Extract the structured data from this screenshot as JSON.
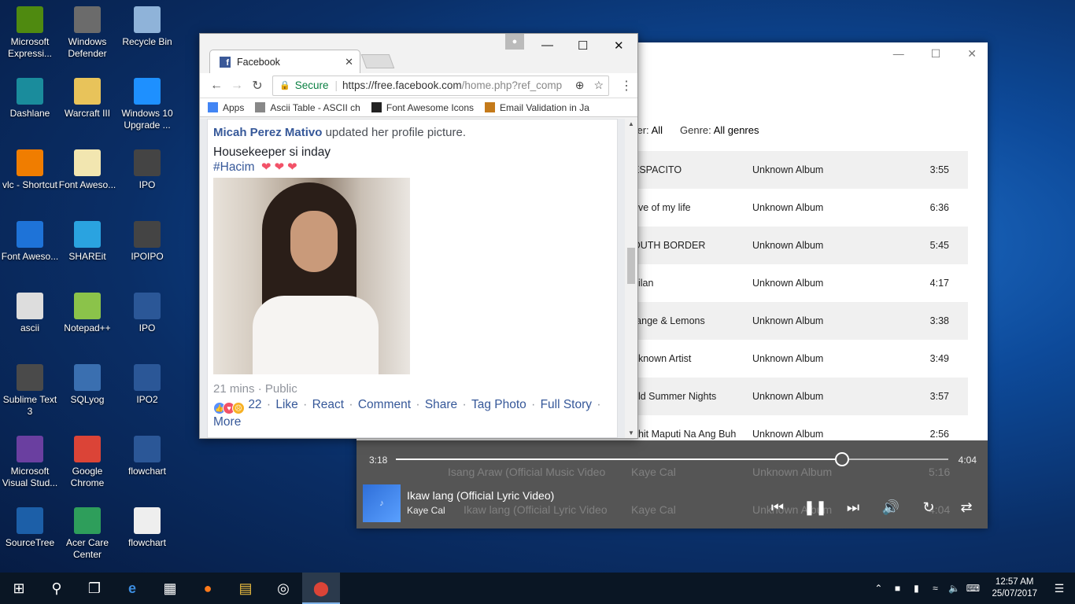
{
  "desktop_icons": [
    {
      "label": "Microsoft Expressi...",
      "icon": "expression-icon",
      "color": "#4f8a10"
    },
    {
      "label": "Windows Defender",
      "icon": "defender-icon",
      "color": "#6b6b6b"
    },
    {
      "label": "Recycle Bin",
      "icon": "recycle-bin-icon",
      "color": "#8fb3d9"
    },
    {
      "label": "Dashlane",
      "icon": "dashlane-icon",
      "color": "#1a8c9c"
    },
    {
      "label": "Warcraft III",
      "icon": "folder-icon",
      "color": "#e8c35a"
    },
    {
      "label": "Windows 10 Upgrade ...",
      "icon": "windows-icon",
      "color": "#1e90ff"
    },
    {
      "label": "vlc - Shortcut",
      "icon": "vlc-icon",
      "color": "#f07d00"
    },
    {
      "label": "Font Aweso...",
      "icon": "document-icon",
      "color": "#f2e6b0"
    },
    {
      "label": "IPO",
      "icon": "file-icon",
      "color": "#444"
    },
    {
      "label": "Font Aweso...",
      "icon": "edge-icon",
      "color": "#1e73d8"
    },
    {
      "label": "SHAREit",
      "icon": "shareit-icon",
      "color": "#2aa3e0"
    },
    {
      "label": "IPOIPO",
      "icon": "file-icon",
      "color": "#444"
    },
    {
      "label": "ascii",
      "icon": "ascii-icon",
      "color": "#ddd"
    },
    {
      "label": "Notepad++",
      "icon": "notepadpp-icon",
      "color": "#8bc34a"
    },
    {
      "label": "IPO",
      "icon": "word-icon",
      "color": "#2b5797"
    },
    {
      "label": "Sublime Text 3",
      "icon": "sublime-icon",
      "color": "#4a4a4a"
    },
    {
      "label": "SQLyog",
      "icon": "sqlyog-icon",
      "color": "#3a6fb0"
    },
    {
      "label": "IPO2",
      "icon": "word-icon",
      "color": "#2b5797"
    },
    {
      "label": "Microsoft Visual Stud...",
      "icon": "visual-studio-icon",
      "color": "#6a3fa0"
    },
    {
      "label": "Google Chrome",
      "icon": "chrome-icon",
      "color": "#db4437"
    },
    {
      "label": "flowchart",
      "icon": "word-icon",
      "color": "#2b5797"
    },
    {
      "label": "SourceTree",
      "icon": "sourcetree-icon",
      "color": "#1c5fa8"
    },
    {
      "label": "Acer Care Center",
      "icon": "acer-icon",
      "color": "#2e9e5b"
    },
    {
      "label": "flowchart",
      "icon": "pdf-icon",
      "color": "#eee"
    }
  ],
  "music": {
    "filter_label": "lter:",
    "filter_value": "All",
    "genre_label": "Genre:",
    "genre_value": "All genres",
    "rows": [
      {
        "title": "ESPACITO",
        "album": "Unknown Album",
        "duration": "3:55"
      },
      {
        "title": "ove of my life",
        "album": "Unknown Album",
        "duration": "6:36"
      },
      {
        "title": "OUTH BORDER",
        "album": "Unknown Album",
        "duration": "5:45"
      },
      {
        "title": "ailan",
        "album": "Unknown Album",
        "duration": "4:17"
      },
      {
        "title": "range & Lemons",
        "album": "Unknown Album",
        "duration": "3:38"
      },
      {
        "title": "nknown Artist",
        "album": "Unknown Album",
        "duration": "3:49"
      },
      {
        "title": "old Summer Nights",
        "album": "Unknown Album",
        "duration": "3:57"
      },
      {
        "title": "ahit Maputi Na Ang Buh",
        "album": "Unknown Album",
        "duration": "2:56"
      }
    ],
    "under_rows": [
      {
        "title": "Isang Araw (Official Music Video",
        "artist": "Kaye Cal",
        "album": "Unknown Album",
        "duration": "5:16"
      },
      {
        "title": "Ikaw lang (Official Lyric Video",
        "artist": "Kaye Cal",
        "album": "Unknown Album",
        "duration": "4:04"
      }
    ],
    "elapsed": "3:18",
    "total": "4:04",
    "progress": 0.807,
    "now_playing_title": "Ikaw lang (Official Lyric Video)",
    "now_playing_artist": "Kaye Cal"
  },
  "chrome": {
    "tab_title": "Facebook",
    "secure_label": "Secure",
    "url_main": "https://free.facebook.com",
    "url_rest": "/home.php?ref_comp",
    "bookmarks": [
      {
        "label": "Apps",
        "icon": "apps-grid-icon"
      },
      {
        "label": "Ascii Table - ASCII ch",
        "icon": "page-icon"
      },
      {
        "label": "Font Awesome Icons",
        "icon": "flag-icon"
      },
      {
        "label": "Email Validation in Ja",
        "icon": "java-icon"
      }
    ],
    "post": {
      "author": "Micah Perez Mativo",
      "action": "updated her profile picture.",
      "message": "Housekeeper si inday",
      "hashtag": "#Hacim",
      "time": "21 mins",
      "privacy": "Public",
      "reactions_count": "22",
      "actions": [
        "Like",
        "React",
        "Comment",
        "Share",
        "Tag Photo",
        "Full Story"
      ],
      "more": "More"
    }
  },
  "taskbar": {
    "time": "12:57 AM",
    "date": "25/07/2017"
  }
}
